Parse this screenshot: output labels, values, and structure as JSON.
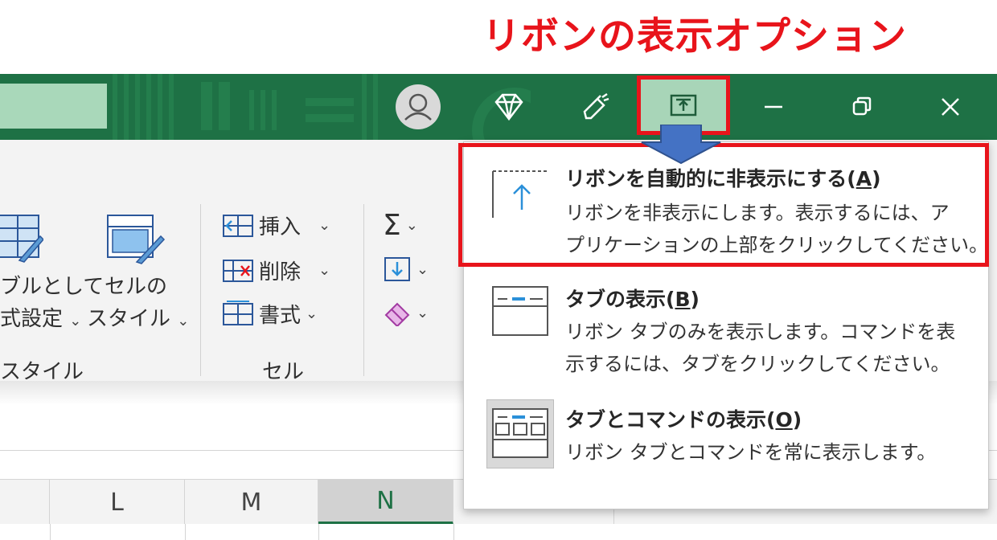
{
  "annotation": {
    "title": "リボンの表示オプション"
  },
  "titlebar": {
    "icons": [
      "gem-icon",
      "pen-icon",
      "ribbon-display-options-icon",
      "minimize-icon",
      "restore-icon",
      "close-icon"
    ],
    "colors": {
      "background": "#1e7145",
      "highlight": "#e8141b"
    }
  },
  "ribbon": {
    "styles_group": {
      "format_as_table_l1": "ブルとして",
      "format_as_table_l2": "式設定",
      "cell_styles_l1": "セルの",
      "cell_styles_l2": "スタイル",
      "group_label": "スタイル"
    },
    "cells_group": {
      "insert": "挿入",
      "delete": "削除",
      "format": "書式",
      "group_label": "セル"
    },
    "editing_group": {
      "sum_icon": "Σ"
    }
  },
  "sheet": {
    "columns": [
      "L",
      "M",
      "N"
    ]
  },
  "menu": {
    "items": [
      {
        "title": "リボンを自動的に非表示にする",
        "hotkey": "A",
        "desc": [
          "リボンを非表示にします。表示するには、ア",
          "プリケーションの上部をクリックしてください。"
        ]
      },
      {
        "title": "タブの表示",
        "hotkey": "B",
        "desc": [
          "リボン タブのみを表示します。コマンドを表",
          "示するには、タブをクリックしてください。"
        ]
      },
      {
        "title": "タブとコマンドの表示",
        "hotkey": "O",
        "desc": [
          "リボン タブとコマンドを常に表示します。"
        ]
      }
    ]
  }
}
